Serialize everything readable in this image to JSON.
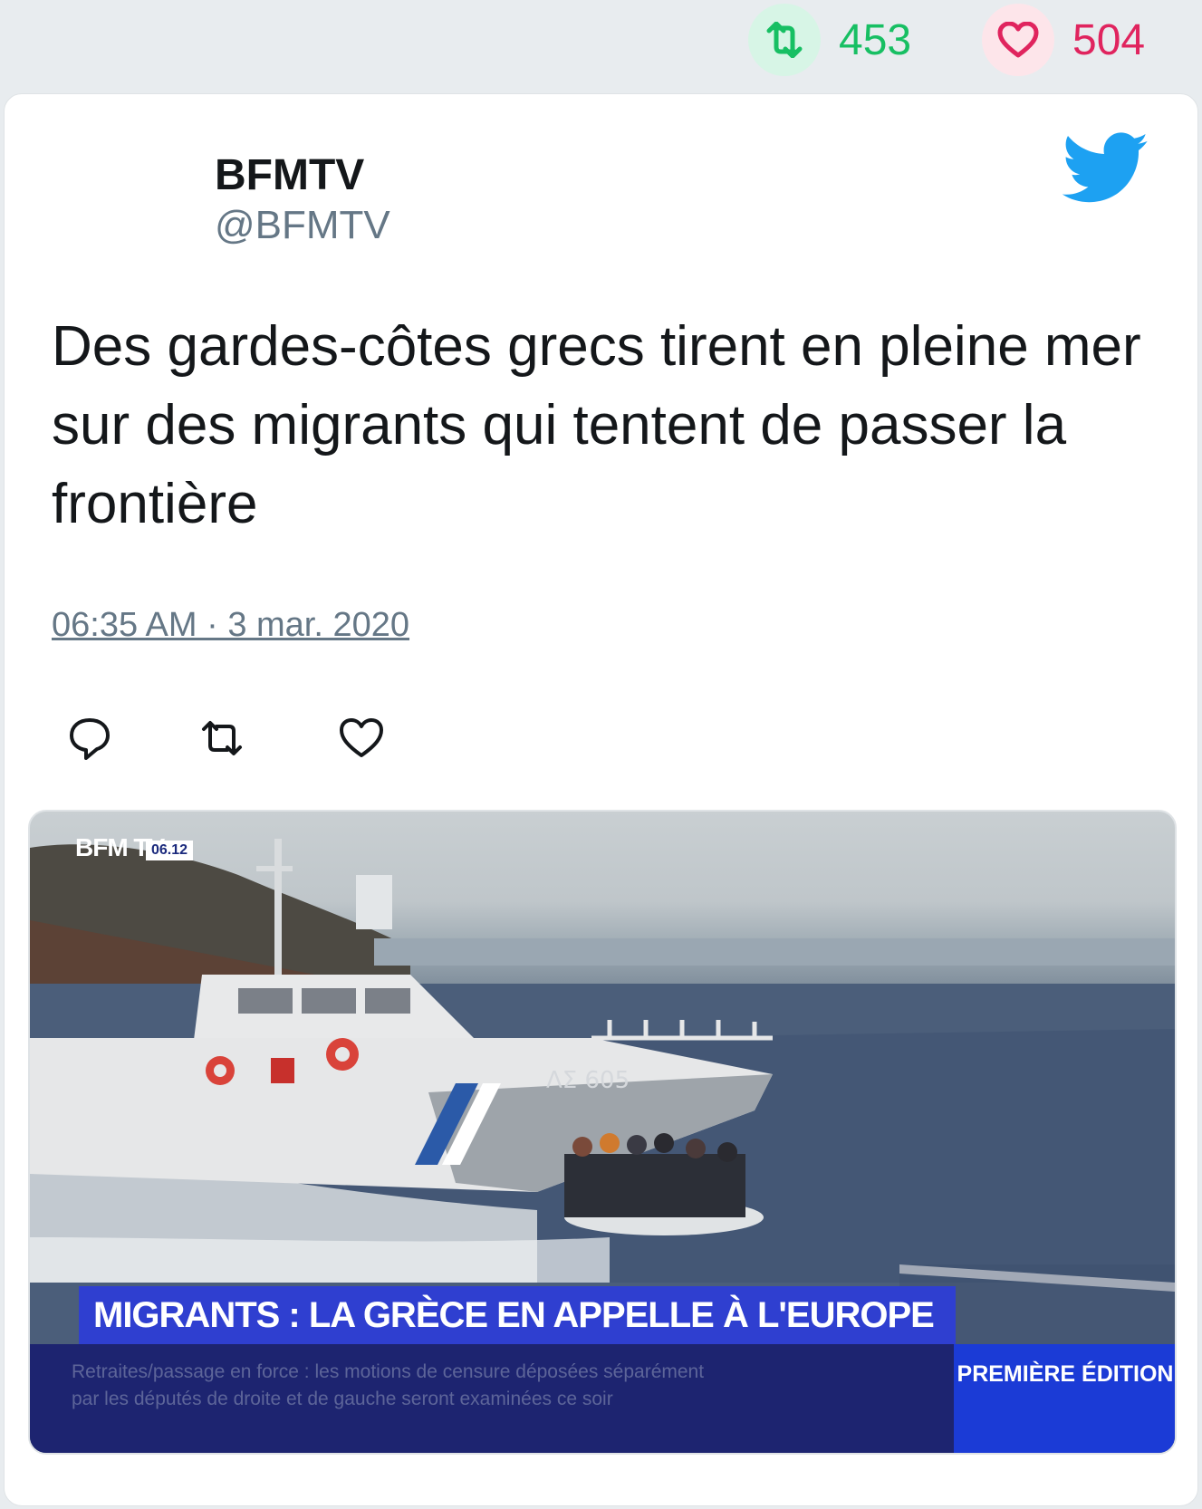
{
  "top_stats": {
    "retweets": "453",
    "likes": "504"
  },
  "tweet": {
    "author_name": "BFMTV",
    "author_handle": "@BFMTV",
    "text": "Des gardes-côtes grecs tirent en pleine mer sur des migrants qui tentent de passer la frontière",
    "timestamp": "06:35 AM · 3 mar. 2020"
  },
  "actions": {
    "icons": [
      "reply-icon",
      "retweet-icon",
      "like-icon"
    ]
  },
  "video": {
    "channel_logo": "BFM TV.",
    "clock": "06.12",
    "headline": "MIGRANTS : LA GRÈCE EN APPELLE À L'EUROPE",
    "ticker_line1": "Retraites/passage en force : les motions de censure déposées séparément",
    "ticker_line2": "par les députés de droite et de gauche seront examinées ce soir",
    "edition_label": "PREMIÈRE ÉDITION",
    "boat_id": "ΛΣ 605"
  },
  "colors": {
    "retweet_green": "#17bf63",
    "like_red": "#e0245e",
    "twitter_blue": "#1da1f2",
    "text_dark": "#14171a",
    "text_gray": "#657786"
  }
}
